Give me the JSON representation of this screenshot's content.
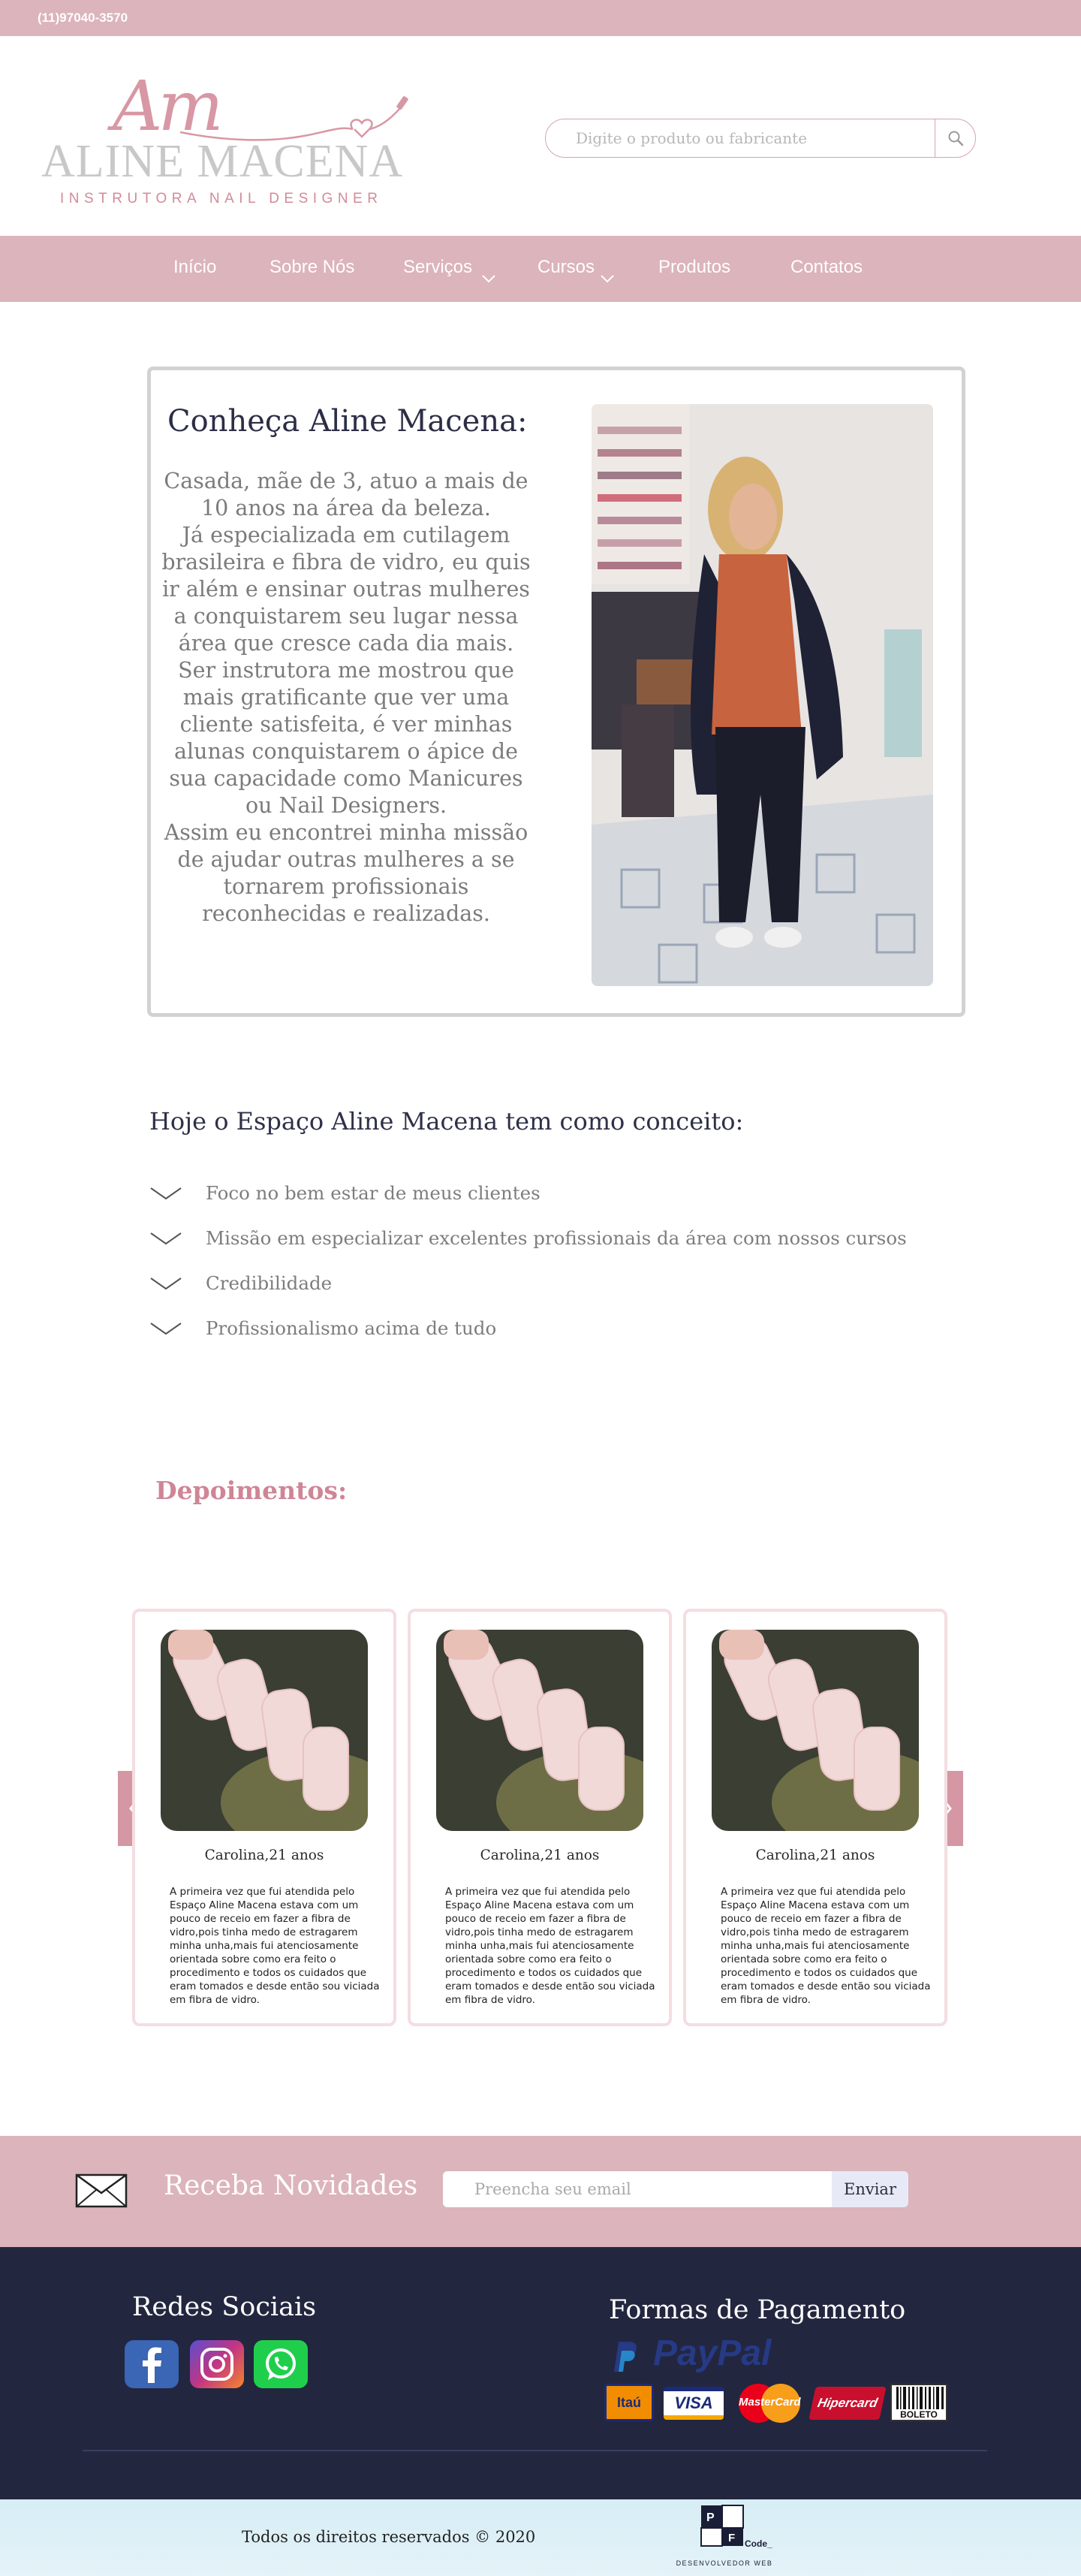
{
  "topbar": {
    "phone": "(11)97040-3570"
  },
  "brand": {
    "monogram": "Am",
    "name": "ALINE MACENA",
    "tagline": "INSTRUTORA NAIL DESIGNER",
    "accent": "#dcb4bb"
  },
  "search": {
    "placeholder": "Digite o produto ou fabricante",
    "icon": "search-icon"
  },
  "nav": {
    "items": [
      {
        "label": "Início"
      },
      {
        "label": "Sobre Nós"
      },
      {
        "label": "Serviços"
      },
      {
        "label": "Cursos"
      },
      {
        "label": "Produtos"
      },
      {
        "label": "Contatos"
      }
    ]
  },
  "about": {
    "title": "Conheça Aline Macena:",
    "paragraphs": [
      "Casada, mãe de 3, atuo a mais de 10 anos na área da beleza.",
      "Já especializada em cutilagem brasileira e fibra de vidro, eu quis ir além e ensinar outras mulheres a conquistarem seu lugar nessa área que cresce cada dia mais.",
      "Ser instrutora me mostrou que mais gratificante que ver uma cliente satisfeita, é ver minhas alunas conquistarem o ápice de sua capacidade como Manicures ou Nail Designers.",
      "Assim eu encontrei minha missão de ajudar outras mulheres a se tornarem profissionais reconhecidas e realizadas."
    ]
  },
  "concept": {
    "title": "Hoje o Espaço Aline Macena tem como conceito:",
    "items": [
      "Foco no bem estar de meus clientes",
      "Missão em especializar excelentes profissionais da área com nossos cursos",
      "Credibilidade",
      "Profissionalismo acima de tudo"
    ]
  },
  "testimonials": {
    "title": "Depoimentos:",
    "cards": [
      {
        "name": "Carolina,21 anos",
        "text": "A primeira vez que fui atendida pelo Espaço Aline Macena estava com um pouco de receio em fazer a fibra de vidro,pois tinha medo de estragarem minha unha,mais fui atenciosamente orientada sobre como era feito o procedimento e todos os cuidados que eram tomados e desde então sou viciada em fibra de vidro."
      },
      {
        "name": "Carolina,21 anos",
        "text": "A primeira vez que fui atendida pelo Espaço Aline Macena estava com um pouco de receio em fazer a fibra de vidro,pois tinha medo de estragarem minha unha,mais fui atenciosamente orientada sobre como era feito o procedimento e todos os cuidados que eram tomados e desde então sou viciada em fibra de vidro."
      },
      {
        "name": "Carolina,21 anos",
        "text": "A primeira vez que fui atendida pelo Espaço Aline Macena estava com um pouco de receio em fazer a fibra de vidro,pois tinha medo de estragarem minha unha,mais fui atenciosamente orientada sobre como era feito o procedimento e todos os cuidados que eram tomados e desde então sou viciada em fibra de vidro."
      }
    ]
  },
  "newsletter": {
    "label": "Receba Novidades",
    "placeholder": "Preencha seu email",
    "button": "Enviar"
  },
  "footer": {
    "social_title": "Redes Sociais",
    "social": [
      "facebook-icon",
      "instagram-icon",
      "whatsapp-icon"
    ],
    "payment_title": "Formas de Pagamento",
    "payment": {
      "paypal": "PayPal",
      "methods": [
        "Itaú",
        "VISA",
        "MasterCard",
        "Hipercard",
        "BOLETO"
      ]
    },
    "dark_bg": "#23263f"
  },
  "bottom": {
    "copyright": "Todos os direitos reservados © 2020",
    "dev_logo": "Code_",
    "dev_caption": "DESENVOLVEDOR WEB"
  }
}
